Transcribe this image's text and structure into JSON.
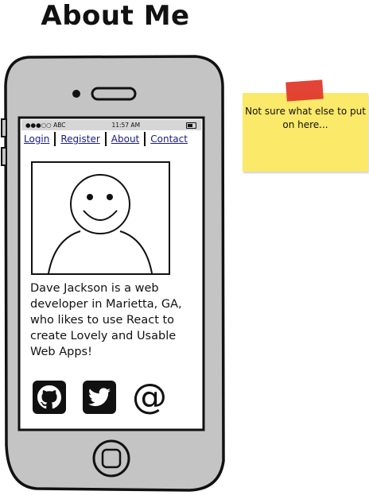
{
  "page": {
    "title": "About Me"
  },
  "phone": {
    "status_bar": {
      "carrier": "●●●○○ ABC",
      "time": "11:57 AM",
      "battery_icon": "battery-icon"
    },
    "nav": {
      "links": [
        "Login",
        "Register",
        "About",
        "Contact"
      ]
    },
    "profile": {
      "avatar_icon": "smiley-face-icon",
      "bio": "Dave Jackson is a web developer in Marietta, GA, who likes to use React to create Lovely and Usable Web Apps!"
    },
    "socials": {
      "github_icon": "github-icon",
      "twitter_icon": "twitter-icon",
      "email_symbol": "@"
    },
    "home_button_icon": "home-button-icon"
  },
  "sticky_note": {
    "text": "Not sure what else to put on here...",
    "color": "#fbe96a",
    "tape_color": "#e03a2c"
  }
}
